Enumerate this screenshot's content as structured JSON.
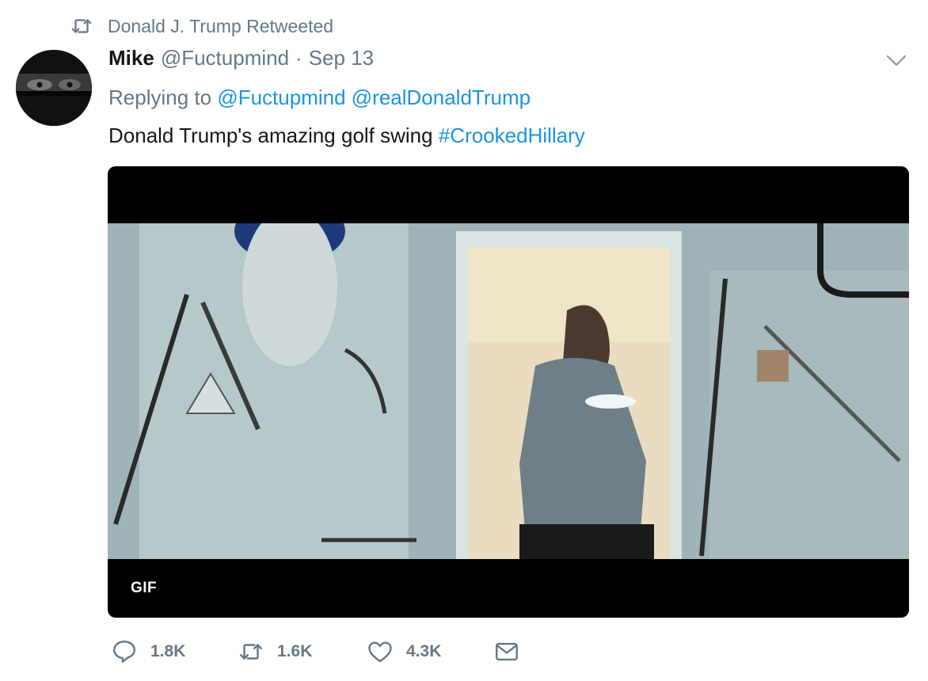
{
  "retweet_context": {
    "icon": "retweet-icon",
    "text": "Donald J. Trump Retweeted"
  },
  "tweet": {
    "author_name": "Mike",
    "author_handle": "@Fuctupmind",
    "separator": "·",
    "date": "Sep 13",
    "replying_prefix": "Replying to",
    "reply_mentions": [
      "@Fuctupmind",
      "@realDonaldTrump"
    ],
    "text": "Donald Trump's amazing golf swing",
    "hashtag": "#CrookedHillary",
    "media_badge": "GIF"
  },
  "actions": [
    {
      "icon": "reply-icon",
      "count": "1.8K"
    },
    {
      "icon": "retweet-icon",
      "count": "1.6K"
    },
    {
      "icon": "like-icon",
      "count": "4.3K"
    },
    {
      "icon": "direct-message-icon"
    }
  ],
  "colors": {
    "link": "#1b95e0",
    "secondary_text": "#657786",
    "primary_text": "#14171a"
  }
}
